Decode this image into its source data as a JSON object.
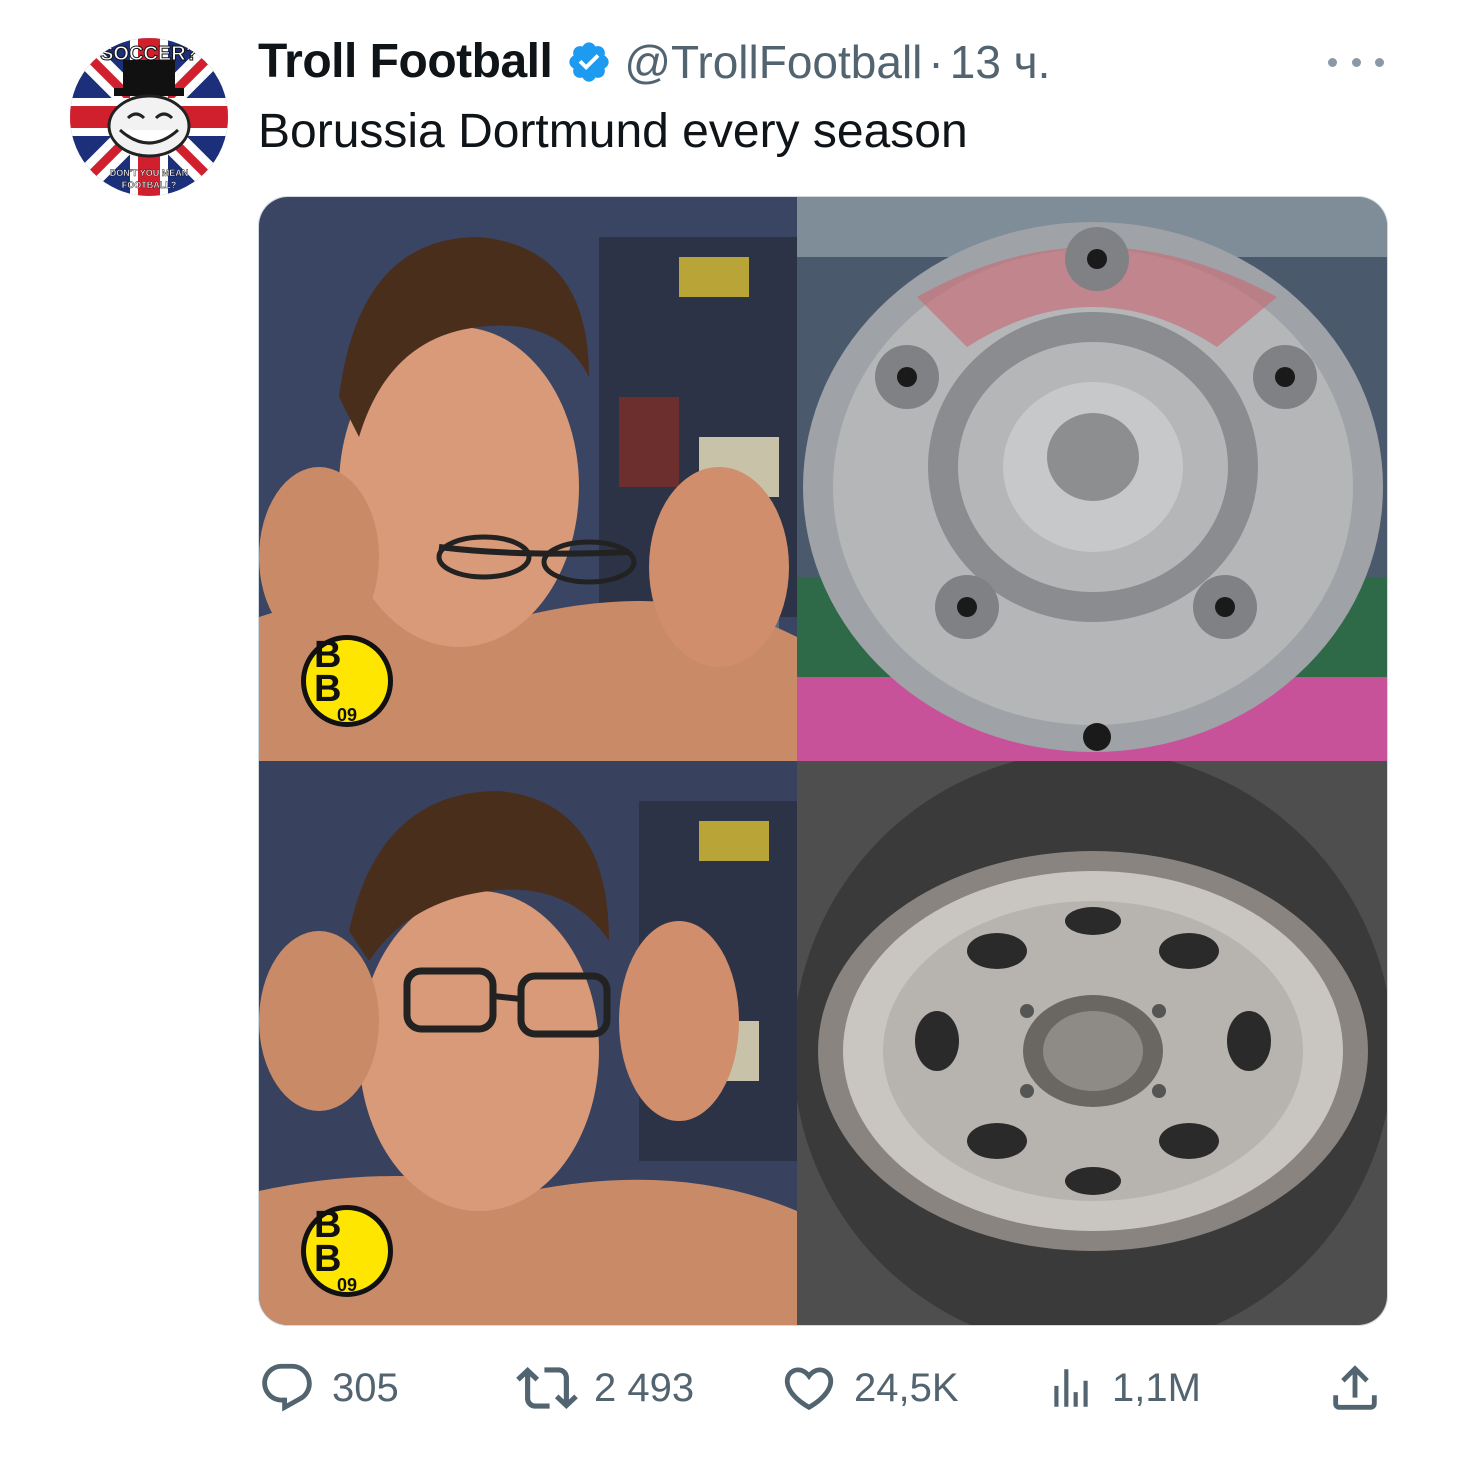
{
  "author": {
    "name": "Troll Football",
    "handle": "@TrollFootball",
    "separator": "·",
    "time": "13 ч.",
    "avatar_icon": "troll-face-union-jack-avatar",
    "avatar_text_top": "SOCCER?",
    "avatar_text_bottom": "DON'T YOU MEAN FOOTBALL?",
    "verified_color": "#1d9bf0"
  },
  "tweet": {
    "text": "Borussia Dortmund every season"
  },
  "media": {
    "panels": [
      {
        "name": "man-removing-glasses",
        "badge": {
          "letters": "B B",
          "year": "09"
        }
      },
      {
        "name": "bundesliga-meisterschale-trophy"
      },
      {
        "name": "man-putting-on-glasses",
        "badge": {
          "letters": "B B",
          "year": "09"
        }
      },
      {
        "name": "rusty-wheel-rim"
      }
    ],
    "badge_color": "#ffe600"
  },
  "actions": {
    "replies": "305",
    "retweets": "2 493",
    "likes": "24,5K",
    "views": "1,1M"
  }
}
